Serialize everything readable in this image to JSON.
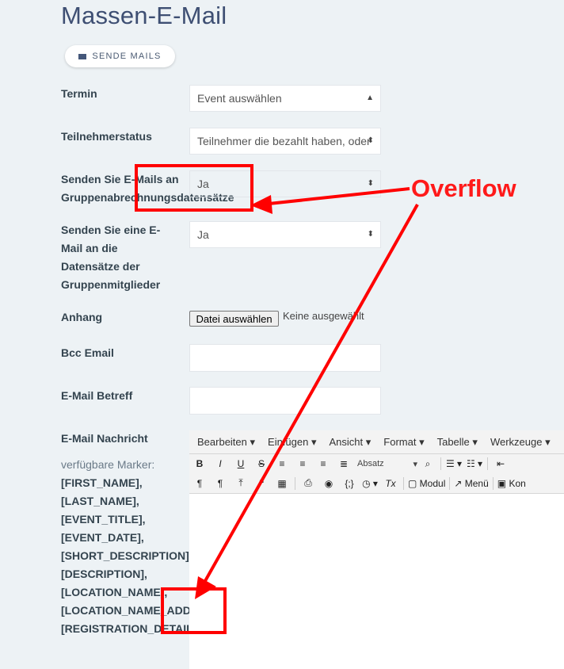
{
  "page": {
    "title": "Massen-E-Mail"
  },
  "toolbar": {
    "send_label": "SENDE MAILS"
  },
  "form": {
    "termin": {
      "label": "Termin",
      "value": "Event auswählen"
    },
    "teilnehmerstatus": {
      "label": "Teilnehmerstatus",
      "value": "Teilnehmer die bezahlt haben, oder Offline"
    },
    "group_billing": {
      "label": "Senden Sie E-Mails an Gruppenabrechnungsdatensätze",
      "label_line1": "Senden Sie E-Mails an",
      "label_line2": "Gruppenabrechnungsdatensätze",
      "value": "Ja"
    },
    "group_members": {
      "label_lines": [
        "Senden Sie eine E-",
        "Mail an die",
        "Datensätze der",
        "Gruppenmitglieder"
      ],
      "value": "Ja"
    },
    "anhang": {
      "label": "Anhang",
      "button": "Datei auswählen",
      "status": "Keine ausgewählt"
    },
    "bcc": {
      "label": "Bcc Email",
      "value": ""
    },
    "subject": {
      "label": "E-Mail Betreff",
      "value": ""
    },
    "message": {
      "label": "E-Mail Nachricht",
      "markers_caption": "verfügbare Marker:",
      "markers": [
        "[FIRST_NAME],",
        "[LAST_NAME],",
        "[EVENT_TITLE],",
        "[EVENT_DATE],",
        "[SHORT_DESCRIPTION],",
        "[DESCRIPTION],",
        "[LOCATION_NAME],",
        "[LOCATION_NAME_ADDRESS],",
        "[REGISTRATION_DETAIL]"
      ]
    }
  },
  "editor": {
    "menus": [
      "Bearbeiten",
      "Einfügen",
      "Ansicht",
      "Format",
      "Tabelle",
      "Werkzeuge"
    ],
    "format_select": "Absatz",
    "modul_label": "Modul",
    "menu_label": "Menü",
    "kon_label": "Kon"
  },
  "annotation": {
    "text": "Overflow",
    "color": "#ff0000"
  }
}
